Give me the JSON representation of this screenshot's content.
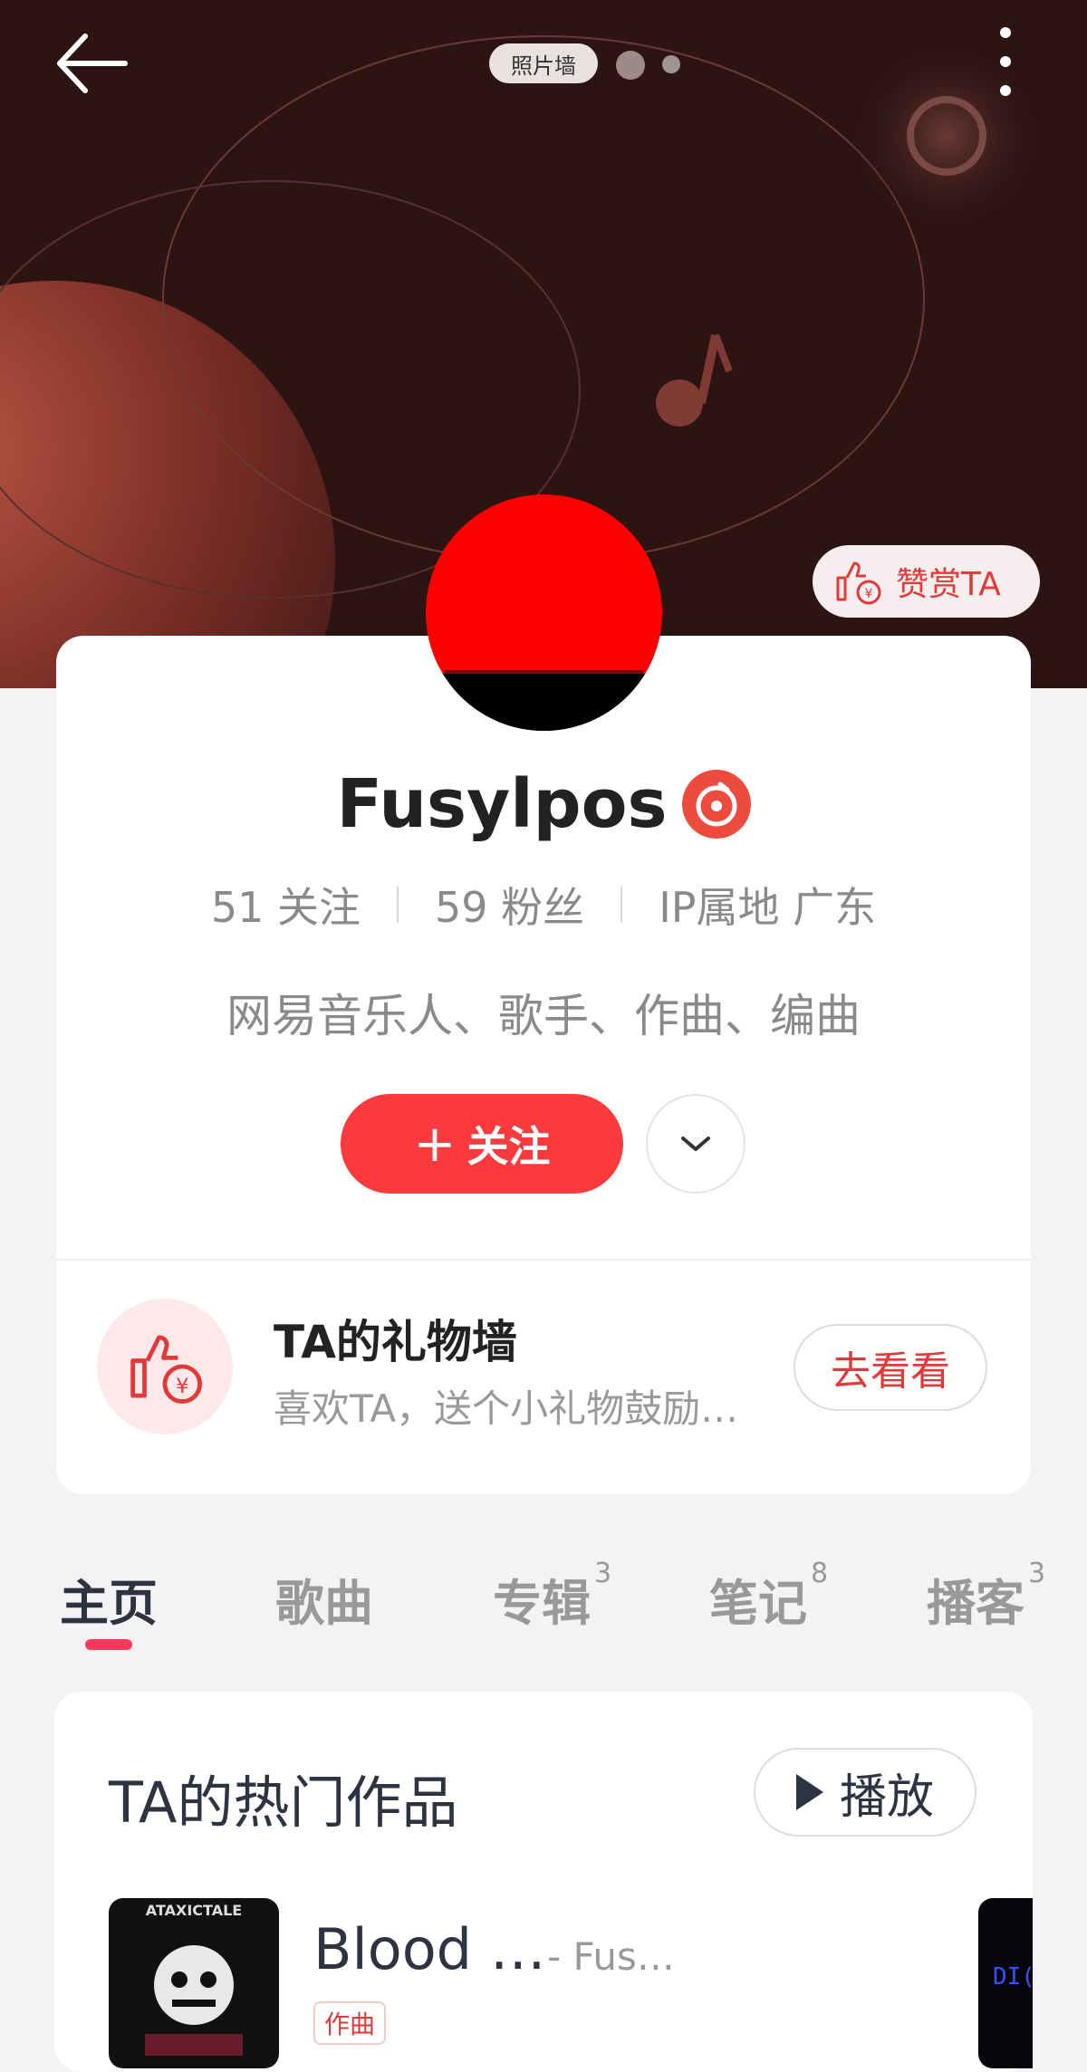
{
  "header": {
    "photo_wall_label": "照片墙",
    "back_icon": "back-arrow-icon",
    "more_icon": "more-vertical-icon"
  },
  "reward": {
    "label": "赞赏TA",
    "icon": "thumbs-up-yen-icon"
  },
  "profile": {
    "name": "Fusylpos",
    "verified_icon": "musician-badge-icon",
    "following": "51 关注",
    "followers": "59 粉丝",
    "ip_location": "IP属地 广东",
    "bio": "网易音乐人、歌手、作曲、编曲",
    "follow_plus": "+",
    "follow_label": "关注"
  },
  "gift": {
    "title": "TA的礼物墙",
    "subtitle": "喜欢TA，送个小礼物鼓励…",
    "button": "去看看"
  },
  "tabs": [
    {
      "label": "主页",
      "count": ""
    },
    {
      "label": "歌曲",
      "count": ""
    },
    {
      "label": "专辑",
      "count": "3"
    },
    {
      "label": "笔记",
      "count": "8"
    },
    {
      "label": "播客",
      "count": "3"
    }
  ],
  "works": {
    "title": "TA的热门作品",
    "play_label": "播放",
    "song": {
      "title": "Blood …",
      "artist": "- Fus…",
      "tag": "作曲",
      "cover_text": "ATAXICTALE"
    },
    "next_cover_text": "DI("
  },
  "colors": {
    "accent": "#fa3a3d",
    "hero_bg": "#2b1412",
    "tab_indicator": "#fa3a5a"
  }
}
